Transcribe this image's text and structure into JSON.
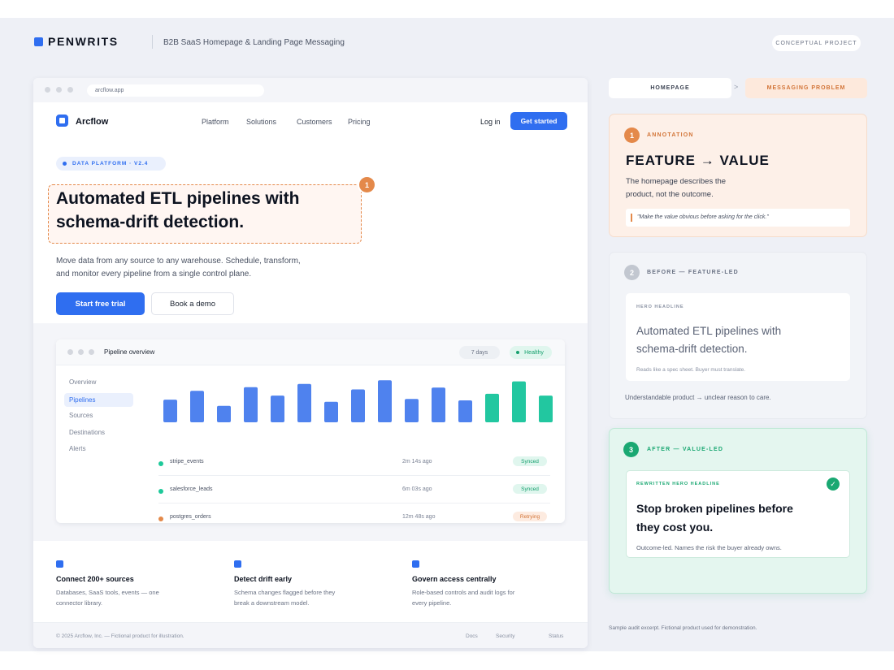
{
  "header": {
    "brand": "PENWRITS",
    "subtitle": "B2B SaaS Homepage & Landing Page Messaging",
    "project_chip": "CONCEPTUAL PROJECT"
  },
  "browser": {
    "url": "arcflow.app",
    "nav": {
      "logo_name": "Arcflow",
      "links": [
        "Platform",
        "Solutions",
        "Customers",
        "Pricing"
      ],
      "login": "Log in",
      "cta": "Get started"
    },
    "hero": {
      "pill": "DATA PLATFORM · V2.4",
      "headline": "Automated ETL pipelines with schema-drift detection.",
      "annotation_number": "1",
      "body": "Move data from any source to any warehouse. Schedule, transform, and monitor every pipeline from a single control plane.",
      "primary_button": "Start free trial",
      "secondary_button": "Book a demo"
    },
    "dashboard": {
      "title": "Pipeline overview",
      "range": "7 days",
      "status": "Healthy",
      "sidebar": [
        "Overview",
        "Pipelines",
        "Sources",
        "Destinations",
        "Alerts"
      ],
      "active_item": "Pipelines",
      "rows": [
        {
          "name": "stripe_events",
          "time": "2m 14s ago",
          "status": "Synced",
          "color": "#1ec99a"
        },
        {
          "name": "salesforce_leads",
          "time": "6m 03s ago",
          "status": "Synced",
          "color": "#1ec99a"
        },
        {
          "name": "postgres_orders",
          "time": "12m 48s ago",
          "status": "Retrying",
          "color": "#e4894a"
        }
      ]
    },
    "features": [
      {
        "title": "Connect 200+ sources",
        "desc": "Databases, SaaS tools, events — one connector library."
      },
      {
        "title": "Detect drift early",
        "desc": "Schema changes flagged before they break a downstream model."
      },
      {
        "title": "Govern access centrally",
        "desc": "Role-based controls and audit logs for every pipeline."
      }
    ],
    "footer": {
      "copyright": "© 2025 Arcflow, Inc. — Fictional product for illustration.",
      "links": [
        "Docs",
        "Security",
        "Status"
      ]
    }
  },
  "chart_data": {
    "type": "bar",
    "title": "",
    "categories": [],
    "series": [
      {
        "values": [
          0.62,
          0.86,
          0.45,
          0.96,
          0.73,
          1.05,
          0.56,
          0.9,
          1.15,
          0.64,
          0.95,
          0.6,
          0.78,
          1.12,
          0.73
        ]
      }
    ],
    "highlight_from_index": 12,
    "colors": {
      "default": "#4f82ee",
      "highlight": "#22c7a0"
    },
    "ylim": [
      0,
      1.2
    ],
    "grid": false,
    "legend": "none"
  },
  "panel": {
    "breadcrumb": [
      "HOMEPAGE",
      "MESSAGING PROBLEM"
    ],
    "breadcrumb_sep": ">",
    "annotation": {
      "number": "1",
      "label": "ANNOTATION",
      "title": "FEATURE → VALUE",
      "body": "The homepage describes the product, not the outcome.",
      "quote": "\"Make the value obvious before asking for the click.\""
    },
    "before": {
      "number": "2",
      "label": "BEFORE — FEATURE-LED",
      "tag": "HERO HEADLINE",
      "headline": "Automated ETL pipelines with schema-drift detection.",
      "caption": "Reads like a spec sheet. Buyer must translate.",
      "footnote": "Understandable product → unclear reason to care."
    },
    "after": {
      "number": "3",
      "label": "AFTER — VALUE-LED",
      "tag": "REWRITTEN HERO HEADLINE",
      "headline": "Stop broken pipelines before they cost you.",
      "caption": "Outcome-led. Names the risk the buyer already owns."
    },
    "note": "Sample audit excerpt. Fictional product used for demonstration."
  },
  "colors": {
    "brand": "#2f6ef0",
    "accent_orange": "#e4894a",
    "accent_green": "#1aa872",
    "background": "#eef0f6"
  }
}
